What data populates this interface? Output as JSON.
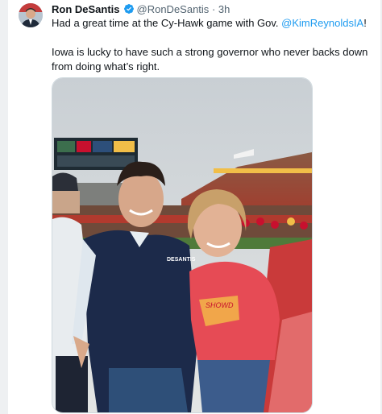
{
  "tweet": {
    "author_name": "Ron DeSantis",
    "handle": "@RonDeSantis",
    "separator": "·",
    "time": "3h",
    "text_line1_before": "Had a great time at the Cy-Hawk game with Gov. ",
    "mention": "@KimReynoldsIA",
    "text_line1_after": "!",
    "text_line2": "Iowa is lucky to have such a strong governor who never backs down from doing what’s right."
  },
  "photo": {
    "shirt_text": "SHOWD",
    "cap_text": "DESANTIS"
  },
  "colors": {
    "verified": "#1d9bf0",
    "mention": "#1d9bf0",
    "cyclone_red": "#c8102e",
    "gold": "#f1be48"
  }
}
